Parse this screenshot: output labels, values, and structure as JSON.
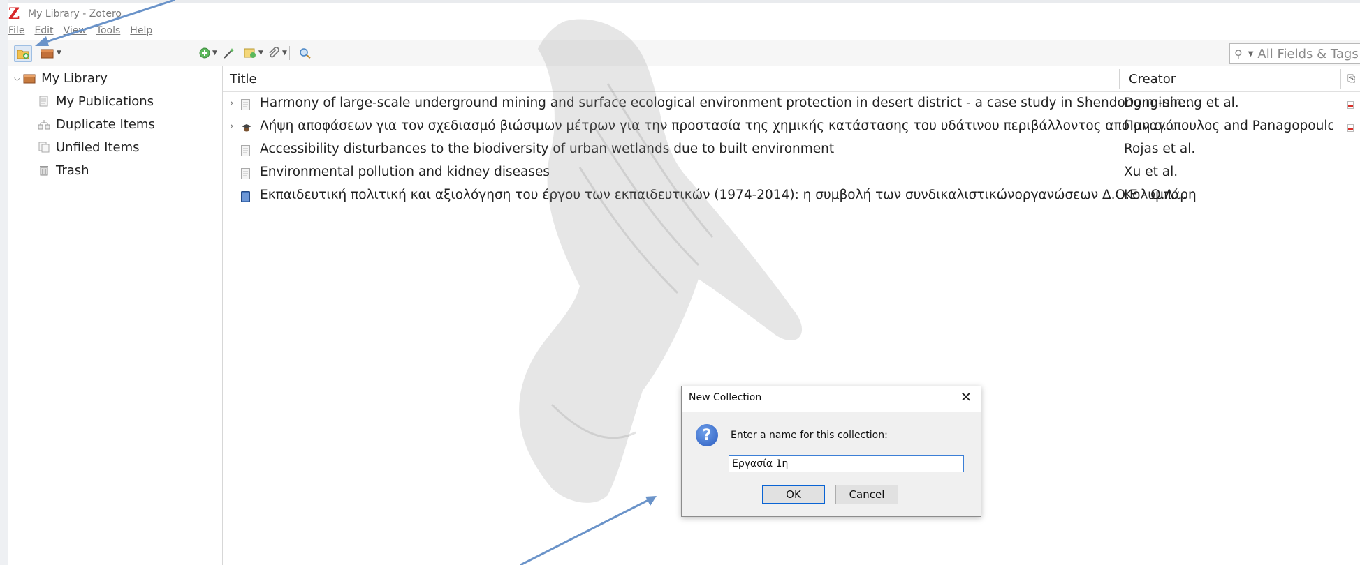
{
  "window": {
    "title": "My Library - Zotero",
    "logo": "Z"
  },
  "menu": [
    "File",
    "Edit",
    "View",
    "Tools",
    "Help"
  ],
  "search": {
    "placeholder": "All Fields & Tags"
  },
  "collections": [
    {
      "label": "My Library",
      "icon": "library-icon"
    },
    {
      "label": "My Publications",
      "icon": "publications-icon"
    },
    {
      "label": "Duplicate Items",
      "icon": "duplicate-icon"
    },
    {
      "label": "Unfiled Items",
      "icon": "unfiled-icon"
    },
    {
      "label": "Trash",
      "icon": "trash-icon"
    }
  ],
  "columns": {
    "title": "Title",
    "creator": "Creator"
  },
  "items": [
    {
      "title": "Harmony of large-scale underground mining and surface ecological environment protection in desert district - a case study in Shendong minin…",
      "creator": "Dong-sheng et al.",
      "type": "document-icon",
      "expandable": true,
      "attachment": "pdf-icon"
    },
    {
      "title": "Λήψη αποφάσεων για τον σχεδιασμό βιώσιμων μέτρων για την προστασία της χημικής κατάστασης του υδάτινου περιβάλλοντος από μη σ…",
      "creator": "Παναγόπουλος and Panagopoulos",
      "type": "thesis-icon",
      "expandable": true,
      "attachment": "pdf-icon"
    },
    {
      "title": "Accessibility disturbances to the biodiversity of urban wetlands due to built environment",
      "creator": "Rojas et al.",
      "type": "document-icon",
      "expandable": false
    },
    {
      "title": "Environmental pollution and kidney diseases",
      "creator": "Xu et al.",
      "type": "document-icon",
      "expandable": false
    },
    {
      "title": "Εκπαιδευτική πολιτική και αξιολόγηση του έργου των εκπαιδευτικών (1974-2014): η συμβολή των συνδικαλιστικώνοργανώσεων Δ.Ο.Ε - Ο.Λ…",
      "creator": "Κολυμπάρη",
      "type": "book-icon",
      "expandable": false
    }
  ],
  "dialog": {
    "title": "New Collection",
    "prompt": "Enter a name for this collection:",
    "value": "Εργασία 1η",
    "ok": "OK",
    "cancel": "Cancel"
  },
  "colors": {
    "accent": "#3c7fd6",
    "brand": "#d8282a",
    "arrow": "#6a93c9"
  }
}
